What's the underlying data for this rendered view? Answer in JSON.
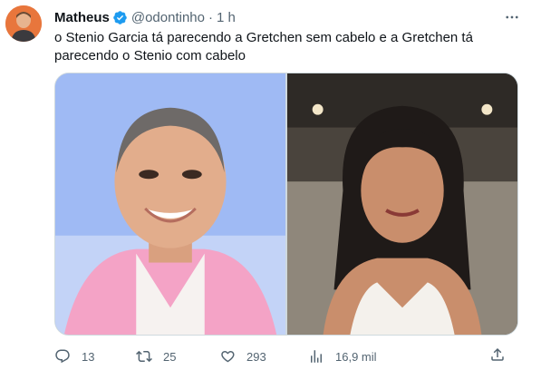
{
  "tweet": {
    "author": {
      "name": "Matheus",
      "handle": "@odontinho",
      "separator": "·",
      "time": "1 h",
      "verified": true
    },
    "text_lines": [
      "o Stenio Garcia tá parecendo a Gretchen sem cabelo e a Gretchen tá",
      "parecendo o Stenio com cabelo"
    ],
    "media": {
      "count": 2
    },
    "actions": {
      "replies": "13",
      "retweets": "25",
      "likes": "293",
      "views": "16,9 mil"
    }
  },
  "colors": {
    "text": "#0f1419",
    "secondary": "#536471",
    "verified": "#1d9bf0",
    "border": "#cfd9de"
  },
  "icons": {
    "verified": "verified-badge-icon",
    "more": "more-options-icon",
    "reply": "reply-icon",
    "retweet": "retweet-icon",
    "like": "like-icon",
    "views": "views-icon",
    "share": "share-icon"
  }
}
